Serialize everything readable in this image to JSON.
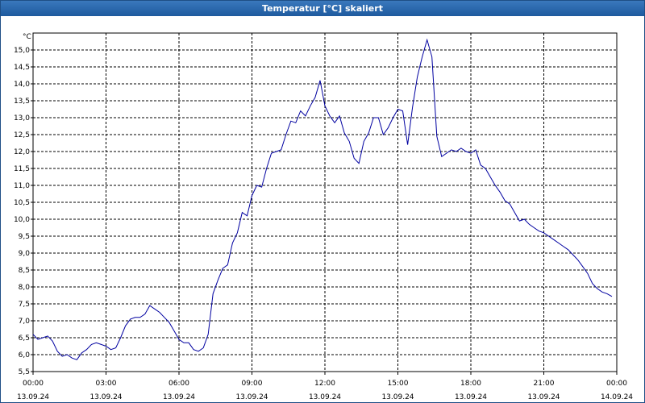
{
  "window": {
    "title": "Temperatur [°C] skaliert"
  },
  "chart_data": {
    "type": "line",
    "title": "Temperatur [°C] skaliert",
    "unit_label": "°C",
    "ylim": [
      5.5,
      15.5
    ],
    "y_ticks": [
      "5,5",
      "6,0",
      "6,5",
      "7,0",
      "7,5",
      "8,0",
      "8,5",
      "9,0",
      "9,5",
      "10,0",
      "10,5",
      "11,0",
      "11,5",
      "12,0",
      "12,5",
      "13,0",
      "13,5",
      "14,0",
      "14,5",
      "15,0"
    ],
    "y_tick_values": [
      5.5,
      6.0,
      6.5,
      7.0,
      7.5,
      8.0,
      8.5,
      9.0,
      9.5,
      10.0,
      10.5,
      11.0,
      11.5,
      12.0,
      12.5,
      13.0,
      13.5,
      14.0,
      14.5,
      15.0
    ],
    "xlim_hours": [
      0,
      24
    ],
    "x_ticks": [
      {
        "time": "00:00",
        "date": "13.09.24"
      },
      {
        "time": "03:00",
        "date": "13.09.24"
      },
      {
        "time": "06:00",
        "date": "13.09.24"
      },
      {
        "time": "09:00",
        "date": "13.09.24"
      },
      {
        "time": "12:00",
        "date": "13.09.24"
      },
      {
        "time": "15:00",
        "date": "13.09.24"
      },
      {
        "time": "18:00",
        "date": "13.09.24"
      },
      {
        "time": "21:00",
        "date": "13.09.24"
      },
      {
        "time": "00:00",
        "date": "14.09.24"
      }
    ],
    "grid": true,
    "line_color": "#0000a0",
    "series": [
      {
        "x": [
          0.0,
          0.2,
          0.4,
          0.6,
          0.8,
          1.0,
          1.2,
          1.4,
          1.6,
          1.8,
          2.0,
          2.2,
          2.4,
          2.6,
          2.8,
          3.0,
          3.2,
          3.4,
          3.6,
          3.8,
          4.0,
          4.2,
          4.4,
          4.6,
          4.8,
          5.0,
          5.2,
          5.4,
          5.6,
          5.8,
          6.0,
          6.2,
          6.4,
          6.6,
          6.8,
          7.0,
          7.2,
          7.4,
          7.6,
          7.8,
          8.0,
          8.2,
          8.4,
          8.6,
          8.8,
          9.0,
          9.2,
          9.4,
          9.6,
          9.8,
          10.0,
          10.2,
          10.4,
          10.6,
          10.8,
          11.0,
          11.2,
          11.4,
          11.6,
          11.8,
          12.0,
          12.2,
          12.4,
          12.6,
          12.8,
          13.0,
          13.2,
          13.4,
          13.6,
          13.8,
          14.0,
          14.2,
          14.4,
          14.6,
          14.8,
          15.0,
          15.2,
          15.4,
          15.6,
          15.8,
          16.0,
          16.2,
          16.4,
          16.6,
          16.8,
          17.0,
          17.2,
          17.4,
          17.6,
          17.8,
          18.0,
          18.2,
          18.4,
          18.6,
          18.8,
          19.0,
          19.2,
          19.4,
          19.6,
          19.8,
          20.0,
          20.2,
          20.4,
          20.6,
          20.8,
          21.0,
          21.2,
          21.4,
          21.6,
          21.8,
          22.0,
          22.2,
          22.4,
          22.6,
          22.8,
          23.0,
          23.2,
          23.4,
          23.6,
          23.8
        ],
        "y": [
          6.6,
          6.45,
          6.5,
          6.55,
          6.4,
          6.1,
          5.95,
          6.0,
          5.9,
          5.85,
          6.05,
          6.15,
          6.3,
          6.35,
          6.3,
          6.25,
          6.15,
          6.2,
          6.5,
          6.85,
          7.05,
          7.1,
          7.1,
          7.2,
          7.45,
          7.35,
          7.25,
          7.1,
          6.95,
          6.7,
          6.45,
          6.35,
          6.35,
          6.15,
          6.1,
          6.2,
          6.6,
          7.8,
          8.2,
          8.55,
          8.65,
          9.3,
          9.6,
          10.2,
          10.1,
          10.7,
          11.0,
          10.95,
          11.5,
          11.95,
          12.0,
          12.05,
          12.5,
          12.9,
          12.85,
          13.2,
          13.05,
          13.35,
          13.6,
          14.1,
          13.35,
          13.05,
          12.85,
          13.05,
          12.55,
          12.3,
          11.8,
          11.65,
          12.3,
          12.55,
          13.0,
          13.0,
          12.5,
          12.7,
          13.0,
          13.25,
          13.2,
          12.2,
          13.3,
          14.2,
          14.8,
          15.3,
          14.8,
          12.45,
          11.85,
          11.95,
          12.05,
          12.0,
          12.1,
          12.0,
          11.95,
          12.05,
          11.6,
          11.5,
          11.25,
          11.0,
          10.8,
          10.55,
          10.45,
          10.2,
          9.95,
          10.0,
          9.85,
          9.75,
          9.65,
          9.6,
          9.5,
          9.4,
          9.3,
          9.2,
          9.1,
          8.95,
          8.8,
          8.6,
          8.4,
          8.1,
          7.95,
          7.85,
          7.8,
          7.72
        ]
      }
    ]
  }
}
